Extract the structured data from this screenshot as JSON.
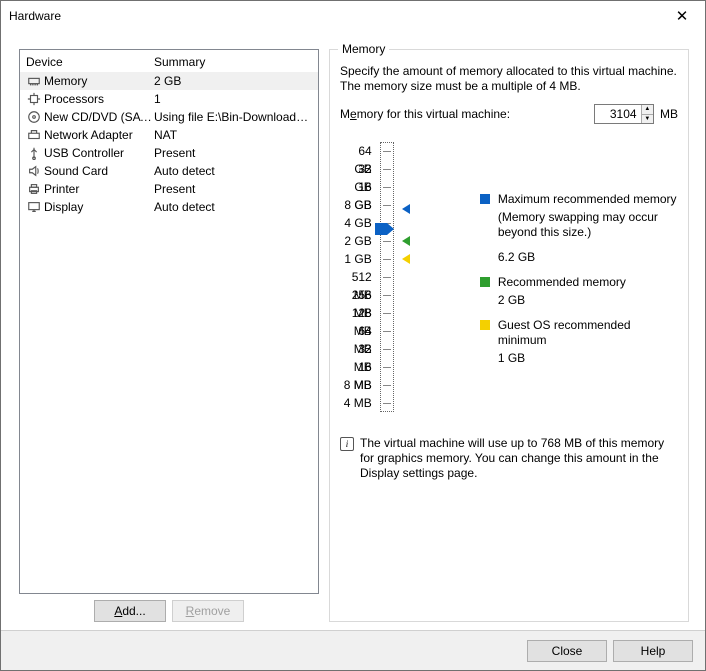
{
  "title": "Hardware",
  "columns": {
    "device": "Device",
    "summary": "Summary"
  },
  "devices": [
    {
      "icon": "memory-icon",
      "name": "Memory",
      "summary": "2 GB",
      "selected": true
    },
    {
      "icon": "cpu-icon",
      "name": "Processors",
      "summary": "1"
    },
    {
      "icon": "disc-icon",
      "name": "New CD/DVD (SATA)",
      "summary": "Using file E:\\Bin-Downloads\\li..."
    },
    {
      "icon": "network-icon",
      "name": "Network Adapter",
      "summary": "NAT"
    },
    {
      "icon": "usb-icon",
      "name": "USB Controller",
      "summary": "Present"
    },
    {
      "icon": "sound-icon",
      "name": "Sound Card",
      "summary": "Auto detect"
    },
    {
      "icon": "printer-icon",
      "name": "Printer",
      "summary": "Present"
    },
    {
      "icon": "display-icon",
      "name": "Display",
      "summary": "Auto detect"
    }
  ],
  "buttons": {
    "add": "Add...",
    "remove": "Remove",
    "close": "Close",
    "help": "Help"
  },
  "memory": {
    "group_label": "Memory",
    "description": "Specify the amount of memory allocated to this virtual machine. The memory size must be a multiple of 4 MB.",
    "field_label_pre": "M",
    "field_label_u": "e",
    "field_label_post": "mory for this virtual machine:",
    "value": "3104",
    "unit": "MB",
    "ticks": [
      "64 GB",
      "32 GB",
      "16 GB",
      "8 GB",
      "4 GB",
      "2 GB",
      "1 GB",
      "512 MB",
      "256 MB",
      "128 MB",
      "64 MB",
      "32 MB",
      "16 MB",
      "8 MB",
      "4 MB"
    ],
    "markers": {
      "max": {
        "color": "#0b61c4",
        "tick_index": 3.2
      },
      "knob": {
        "color": "#0b61c4",
        "tick_index": 4.3
      },
      "rec": {
        "color": "#2f9e2f",
        "tick_index": 5.0
      },
      "min": {
        "color": "#f4d000",
        "tick_index": 6.0
      }
    },
    "legend": {
      "max_label": "Maximum recommended memory",
      "max_note": "(Memory swapping may occur beyond this size.)",
      "max_value": "6.2 GB",
      "rec_label": "Recommended memory",
      "rec_value": "2 GB",
      "min_label": "Guest OS recommended minimum",
      "min_value": "1 GB"
    },
    "info": "The virtual machine will use up to 768 MB of this memory for graphics memory. You can change this amount in the Display settings page."
  },
  "add_u": "A",
  "add_post": "dd...",
  "remove_pre": "",
  "remove_u": "R",
  "remove_post": "emove"
}
